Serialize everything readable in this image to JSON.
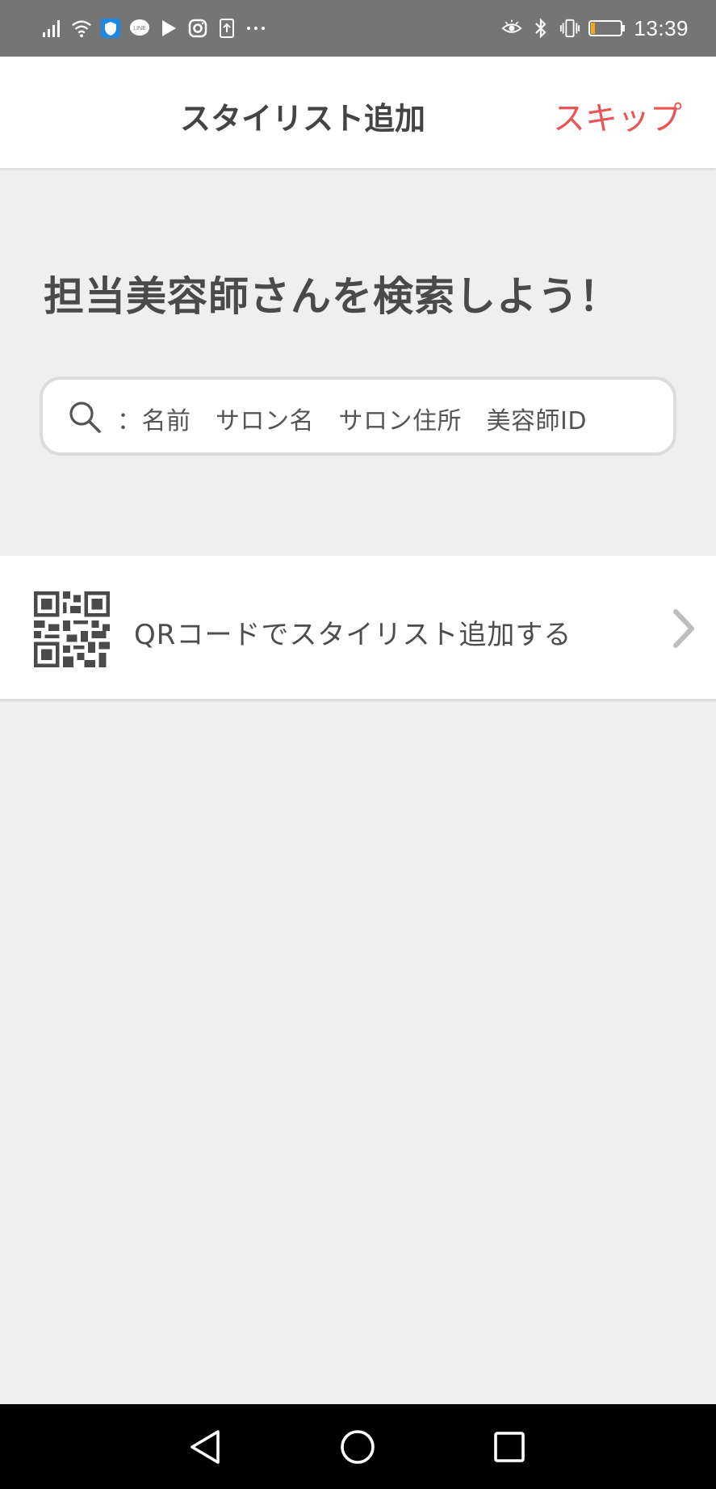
{
  "status_bar": {
    "time": "13:39",
    "left_icons": [
      "signal-icon",
      "wifi-icon",
      "shield-icon",
      "line-icon",
      "play-store-icon",
      "instagram-icon",
      "upload-icon",
      "more-icon"
    ],
    "right_icons": [
      "eye-comfort-icon",
      "bluetooth-icon",
      "vibrate-icon",
      "battery-icon"
    ],
    "battery_level": 0.15,
    "battery_color": "#f5a623"
  },
  "header": {
    "title": "スタイリスト追加",
    "skip_label": "スキップ"
  },
  "main": {
    "heading": "担当美容師さんを検索しよう！",
    "search": {
      "placeholder": "：名前　サロン名　サロン住所　美容師ID",
      "icon": "search-icon"
    },
    "qr_row": {
      "label": "QRコードでスタイリスト追加する",
      "icon": "qr-code-icon",
      "arrow_icon": "chevron-right-icon"
    }
  },
  "nav_bar": {
    "buttons": [
      "back-icon",
      "home-icon",
      "recents-icon"
    ]
  },
  "colors": {
    "accent": "#ea5454",
    "background": "#efefef",
    "text": "#4a4a4a"
  }
}
